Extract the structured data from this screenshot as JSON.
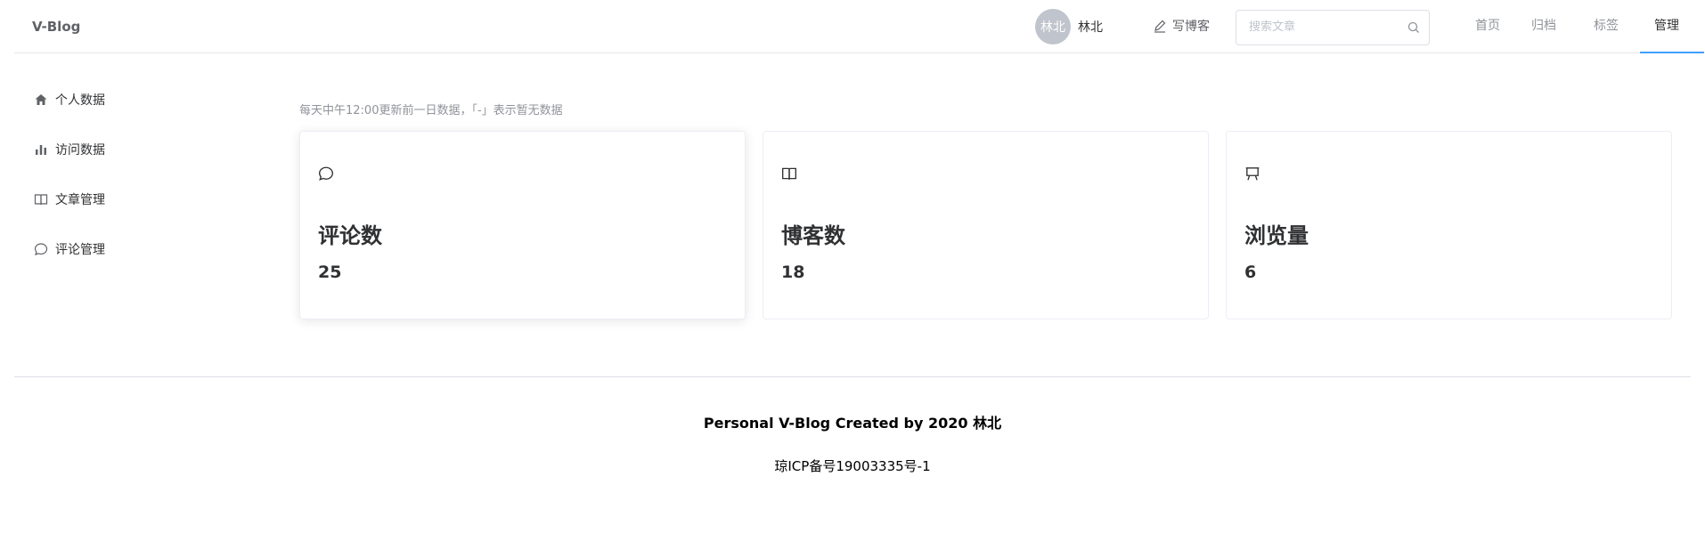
{
  "header": {
    "logo": "V-Blog",
    "avatar_text": "林北",
    "username": "林北",
    "write_label": "写博客",
    "search_placeholder": "搜索文章",
    "nav": [
      {
        "label": "首页"
      },
      {
        "label": "归档"
      },
      {
        "label": "标签"
      },
      {
        "label": "管理",
        "active": true
      }
    ]
  },
  "sidebar": {
    "items": [
      {
        "label": "个人数据",
        "icon": "home-icon"
      },
      {
        "label": "访问数据",
        "icon": "bar-chart-icon"
      },
      {
        "label": "文章管理",
        "icon": "book-icon"
      },
      {
        "label": "评论管理",
        "icon": "comment-icon"
      }
    ]
  },
  "main": {
    "notice": "每天中午12:00更新前一日数据，「-」表示暂无数据",
    "cards": [
      {
        "title": "评论数",
        "value": "25",
        "icon": "comment-icon"
      },
      {
        "title": "博客数",
        "value": "18",
        "icon": "book-icon"
      },
      {
        "title": "浏览量",
        "value": "6",
        "icon": "presentation-icon"
      }
    ]
  },
  "footer": {
    "title": "Personal V-Blog Created by 2020 林北",
    "icp": "琼ICP备号19003335号-1"
  },
  "colors": {
    "accent": "#409eff",
    "avatar_bg": "#c0c4cc",
    "border": "#ebeef5"
  }
}
